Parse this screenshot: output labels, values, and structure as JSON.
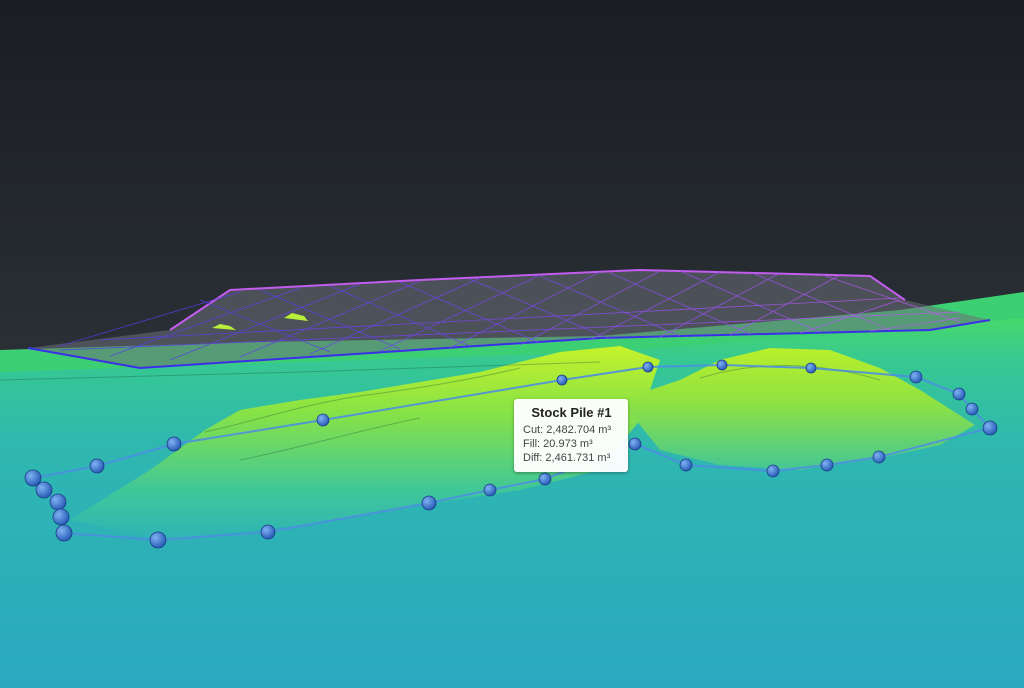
{
  "scene": {
    "view": "3d-point-cloud",
    "background_color": "#1e2227",
    "terrain_colors": [
      "#28a9c4",
      "#3fcf9f",
      "#66e35a",
      "#b7f22c"
    ],
    "reference_mesh_colors": [
      "#3a30e8",
      "#9a4cf0",
      "#c45cf0"
    ],
    "boundary_color": "#4d8fe0",
    "handle_color": "#2f6fc9"
  },
  "stockpile": {
    "title": "Stock Pile #1",
    "cut_label": "Cut:",
    "cut_value": "2,482.704 m³",
    "fill_label": "Fill:",
    "fill_value": "20.973 m³",
    "diff_label": "Diff:",
    "diff_value": "2,461.731 m³"
  }
}
